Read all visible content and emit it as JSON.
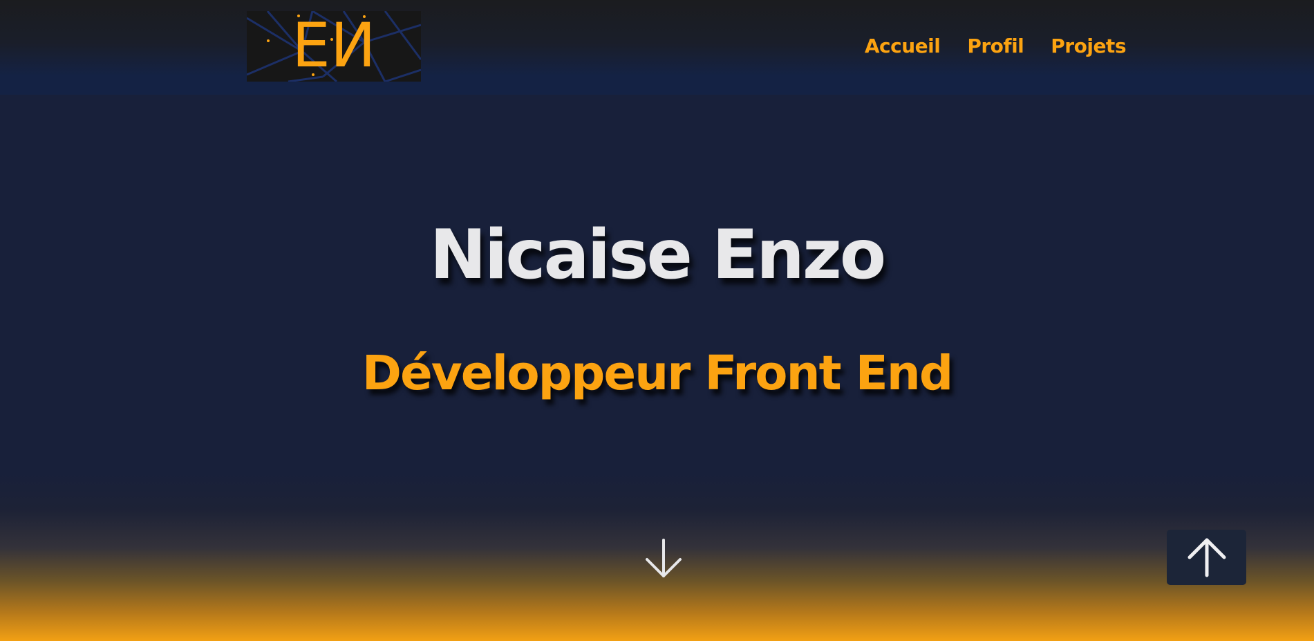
{
  "header": {
    "logo": {
      "text": "EИ",
      "icon": "logo-constellation"
    },
    "nav": [
      {
        "label": "Accueil"
      },
      {
        "label": "Profil"
      },
      {
        "label": "Projets"
      }
    ]
  },
  "hero": {
    "title": "Nicaise Enzo",
    "subtitle": "Développeur Front End",
    "scroll_down_icon": "arrow-down-icon",
    "back_to_top_icon": "arrow-up-icon"
  },
  "colors": {
    "accent": "#fca311",
    "background": "#18203a",
    "header_dark": "#1b1c1f",
    "text_light": "#e8e8ea"
  }
}
